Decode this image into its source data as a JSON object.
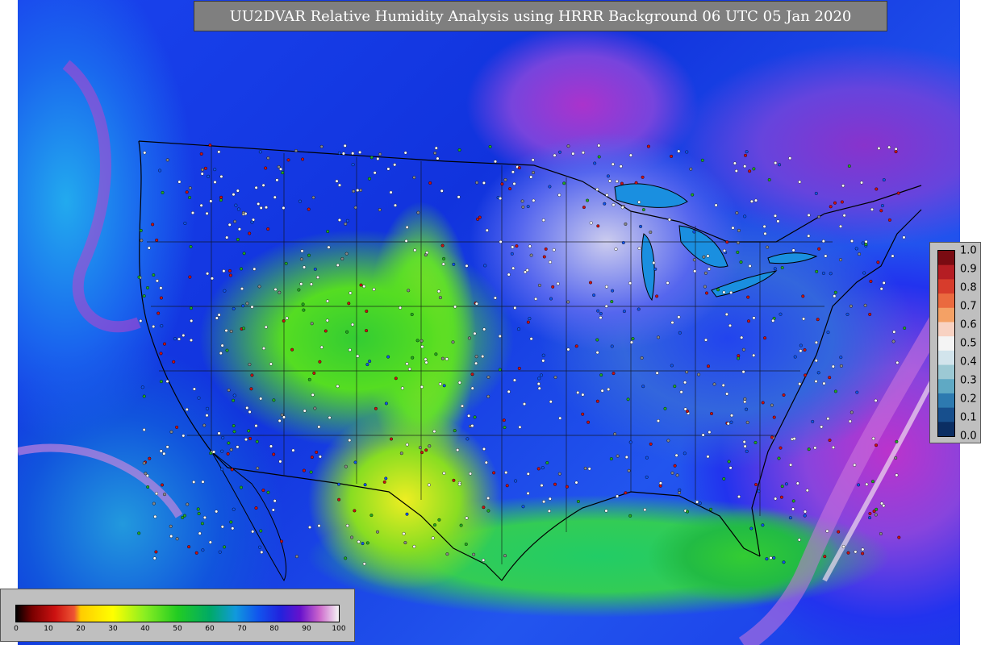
{
  "title": "UU2DVAR Relative Humidity Analysis using HRRR Background 06 UTC 05 Jan 2020",
  "humidity_colorbar": {
    "min": 0,
    "max": 100,
    "tick_labels": [
      "0",
      "10",
      "20",
      "30",
      "40",
      "50",
      "60",
      "70",
      "80",
      "90",
      "100"
    ],
    "color_stops": [
      {
        "value": 0,
        "color": "#000000"
      },
      {
        "value": 5,
        "color": "#7a0000"
      },
      {
        "value": 12,
        "color": "#cc1111"
      },
      {
        "value": 18,
        "color": "#ee5533"
      },
      {
        "value": 20,
        "color": "#ffcc00"
      },
      {
        "value": 30,
        "color": "#ffff00"
      },
      {
        "value": 40,
        "color": "#88ee22"
      },
      {
        "value": 50,
        "color": "#22cc22"
      },
      {
        "value": 60,
        "color": "#00aa66"
      },
      {
        "value": 68,
        "color": "#1199dd"
      },
      {
        "value": 75,
        "color": "#1155ee"
      },
      {
        "value": 82,
        "color": "#2222dd"
      },
      {
        "value": 88,
        "color": "#6611cc"
      },
      {
        "value": 94,
        "color": "#cc66cc"
      },
      {
        "value": 100,
        "color": "#f5f5f5"
      }
    ]
  },
  "uncertainty_colorbar": {
    "tick_labels": [
      "1.0",
      "0.9",
      "0.8",
      "0.7",
      "0.6",
      "0.5",
      "0.4",
      "0.3",
      "0.2",
      "0.1",
      "0.0"
    ],
    "colors_top_to_bottom": [
      "#7a0b12",
      "#b51d23",
      "#d73c2c",
      "#ea6a3f",
      "#f4a165",
      "#f8d2c2",
      "#f4f4f4",
      "#d2e4ec",
      "#9cc9d4",
      "#5fa9c4",
      "#2d7ab0",
      "#174f8d",
      "#0b2e63"
    ]
  },
  "map": {
    "background_field": "relative humidity",
    "station_markers": "observation stations"
  }
}
